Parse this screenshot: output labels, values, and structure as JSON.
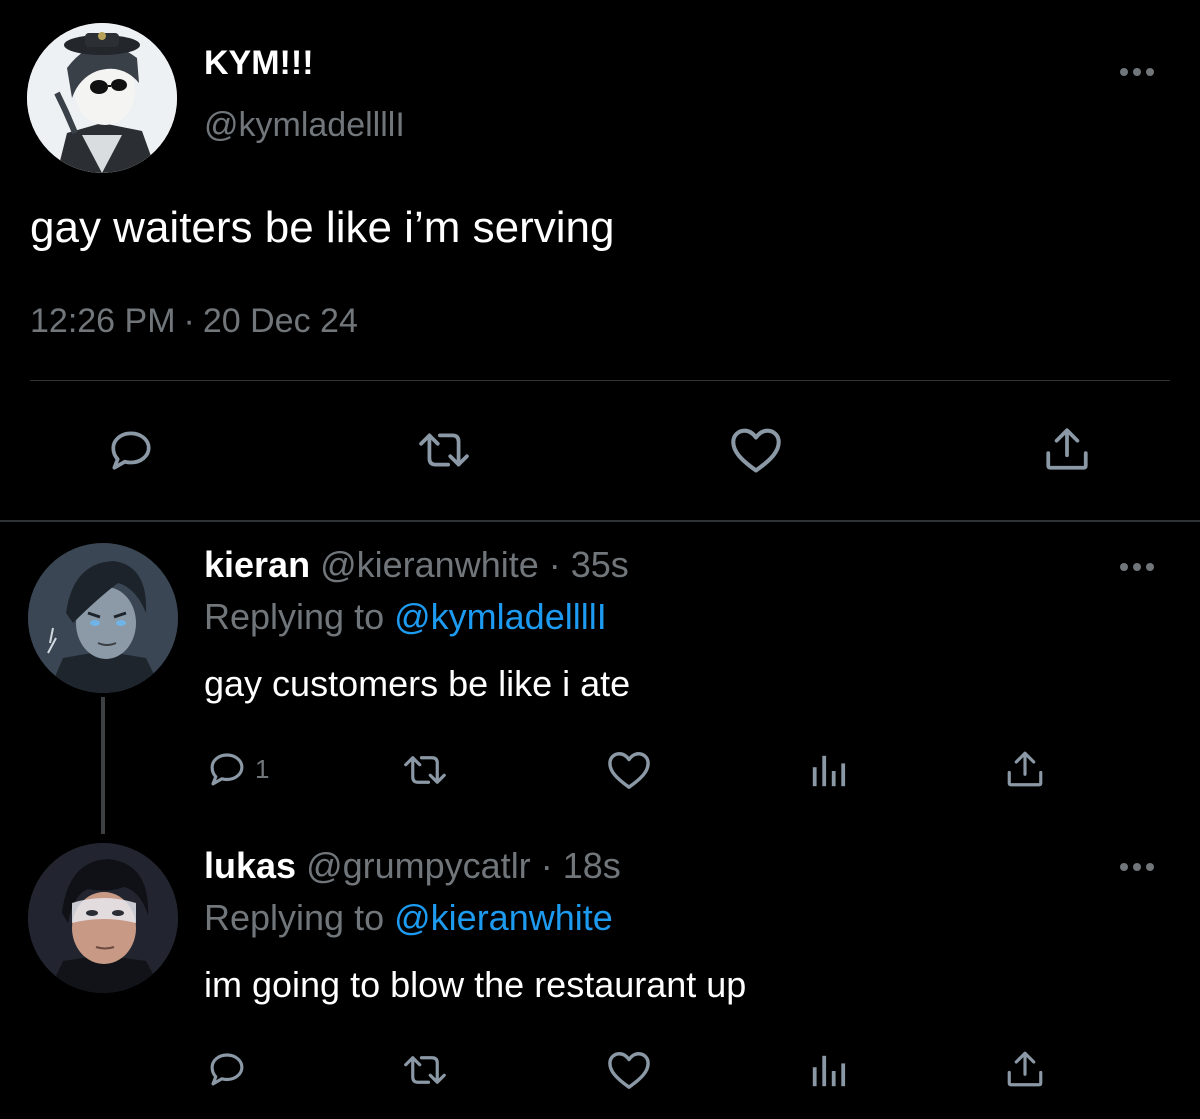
{
  "main_tweet": {
    "author_name": "KYM!!!",
    "author_handle": "@kymladellllI",
    "text": "gay waiters be like i’m serving",
    "time": "12:26 PM",
    "separator": "·",
    "date": "20 Dec 24",
    "actions": [
      "reply-icon",
      "retweet-icon",
      "like-icon",
      "share-icon"
    ]
  },
  "replies": [
    {
      "name": "kieran",
      "handle": "@kieranwhite",
      "separator": "·",
      "age": "35s",
      "replying_prefix": "Replying to",
      "replying_to": "@kymladellllI",
      "text": "gay customers be like i ate",
      "reply_count": "1",
      "actions": [
        "reply-icon",
        "retweet-icon",
        "like-icon",
        "views-icon",
        "share-icon"
      ]
    },
    {
      "name": "lukas",
      "handle": "@grumpycatlr",
      "separator": "·",
      "age": "18s",
      "replying_prefix": "Replying to",
      "replying_to": "@kieranwhite",
      "text": "im going to blow the restaurant up",
      "actions": [
        "reply-icon",
        "retweet-icon",
        "like-icon",
        "views-icon",
        "share-icon"
      ]
    }
  ],
  "colors": {
    "background": "#000000",
    "primary_text": "#ffffff",
    "secondary_text": "#71767b",
    "link": "#1d9bf0",
    "divider": "#2f3336"
  }
}
